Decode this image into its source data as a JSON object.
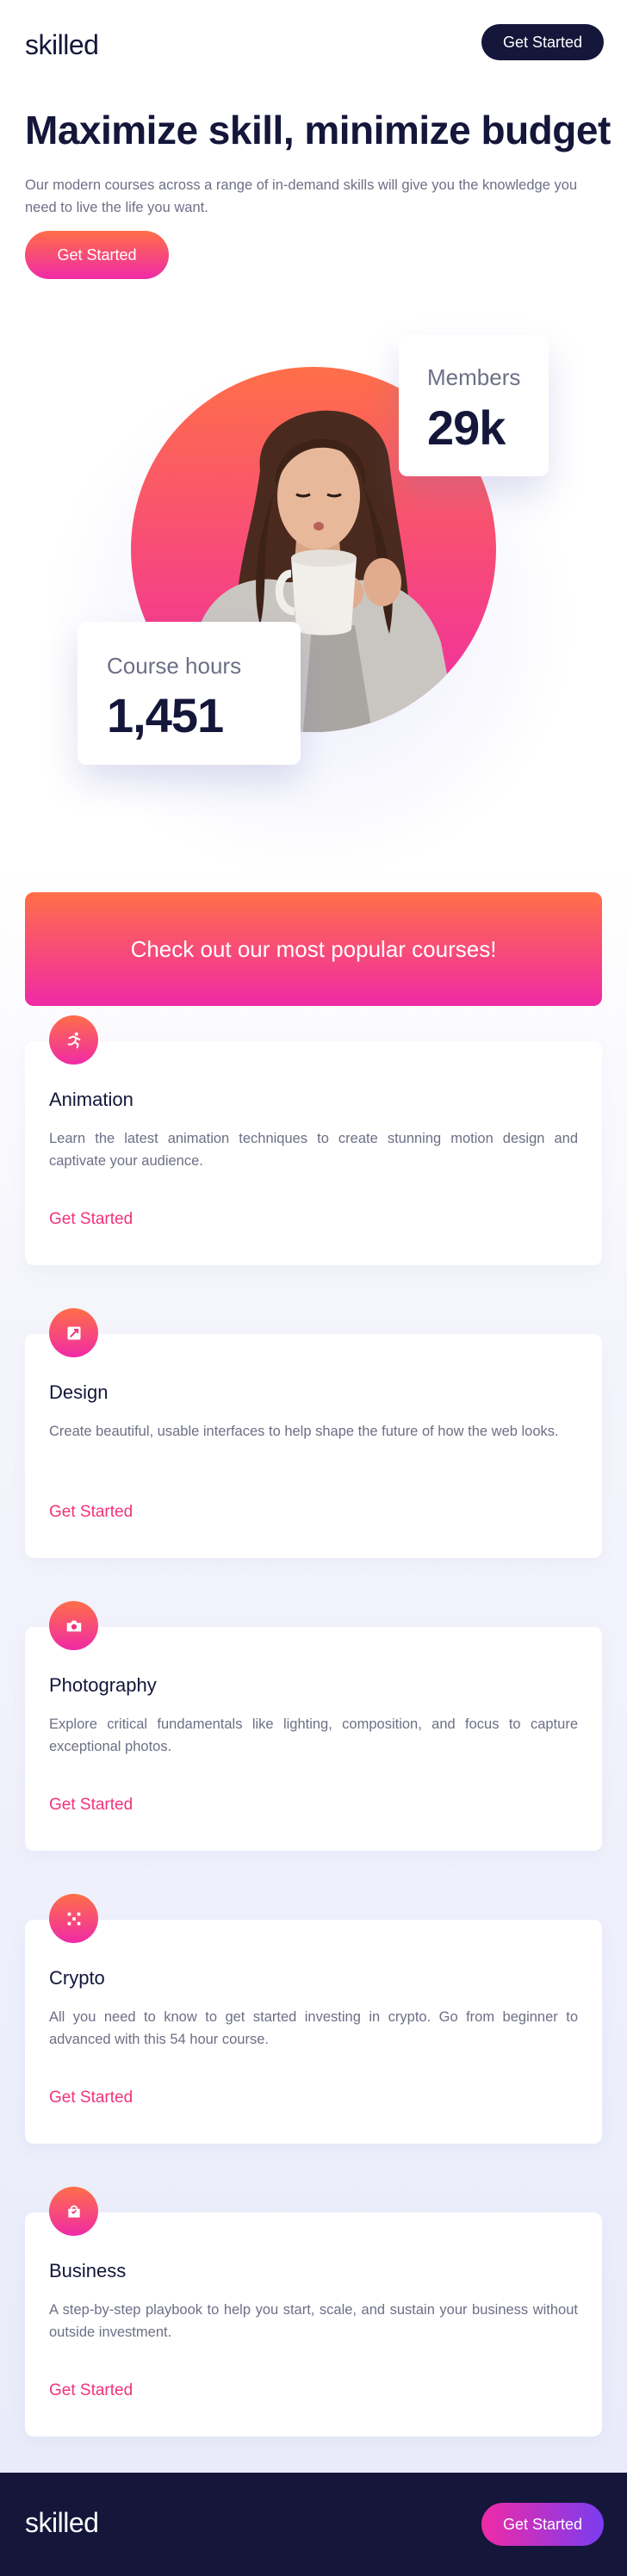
{
  "header": {
    "logo": "skilled",
    "cta_label": "Get Started"
  },
  "hero": {
    "title": "Maximize skill, minimize budget",
    "text": "Our modern courses across a range of in-demand skills will give you the knowledge you need to live the life you want.",
    "cta_label": "Get Started"
  },
  "stats": {
    "members": {
      "label": "Members",
      "value": "29k"
    },
    "hours": {
      "label": "Course hours",
      "value": "1,451"
    }
  },
  "banner": {
    "text": "Check out our most popular courses!"
  },
  "courses": [
    {
      "icon": "running-figure-icon",
      "title": "Animation",
      "description": "Learn the latest animation techniques to create stunning motion design and captivate your audience.",
      "link": "Get Started"
    },
    {
      "icon": "image-frame-icon",
      "title": "Design",
      "description": "Create beautiful, usable interfaces to help shape the future of how the web looks.",
      "link": "Get Started"
    },
    {
      "icon": "camera-icon",
      "title": "Photography",
      "description": "Explore critical fundamentals like lighting, composition, and focus to capture exceptional photos.",
      "link": "Get Started"
    },
    {
      "icon": "crypto-icon",
      "title": "Crypto",
      "description": "All you need to know to get started investing in crypto. Go from beginner to advanced with this 54 hour course.",
      "link": "Get Started"
    },
    {
      "icon": "briefcase-icon",
      "title": "Business",
      "description": "A step-by-step playbook to help you start, scale, and sustain your business without outside investment.",
      "link": "Get Started"
    }
  ],
  "footer": {
    "logo": "skilled",
    "cta_label": "Get Started"
  },
  "colors": {
    "navy": "#14163a",
    "gradient_start": "#ff6f48",
    "gradient_end": "#f02aa6",
    "link": "#f0337a",
    "footer_button_end": "#7a3cf0",
    "muted_text": "#6d6f86"
  }
}
